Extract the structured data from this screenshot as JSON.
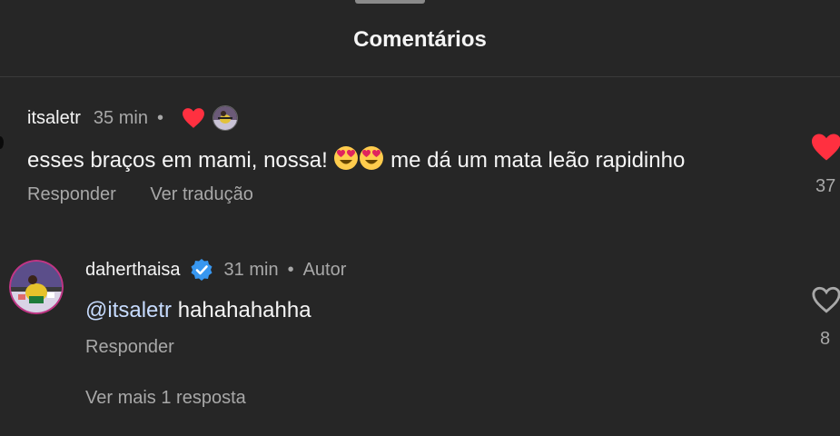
{
  "header": {
    "title": "Comentários"
  },
  "comment": {
    "username": "itsaletr",
    "time": "35 min",
    "separator": "•",
    "text_part1": "esses braços em mami, nossa! ",
    "text_part2": " me dá um mata leão rapidinho",
    "emoji_icon": "heart-eyes-emoji",
    "reply_label": "Responder",
    "translate_label": "Ver tradução",
    "like_count": "37",
    "liked": true,
    "like_color": "#ff3040"
  },
  "reply": {
    "username": "daherthaisa",
    "verified": true,
    "verified_color": "#3897f0",
    "time": "31 min",
    "separator": "•",
    "role": "Autor",
    "mention": "@itsaletr",
    "text": " hahahahahha",
    "reply_label": "Responder",
    "like_count": "8",
    "liked": false
  },
  "more_replies_label": "Ver mais 1 resposta"
}
